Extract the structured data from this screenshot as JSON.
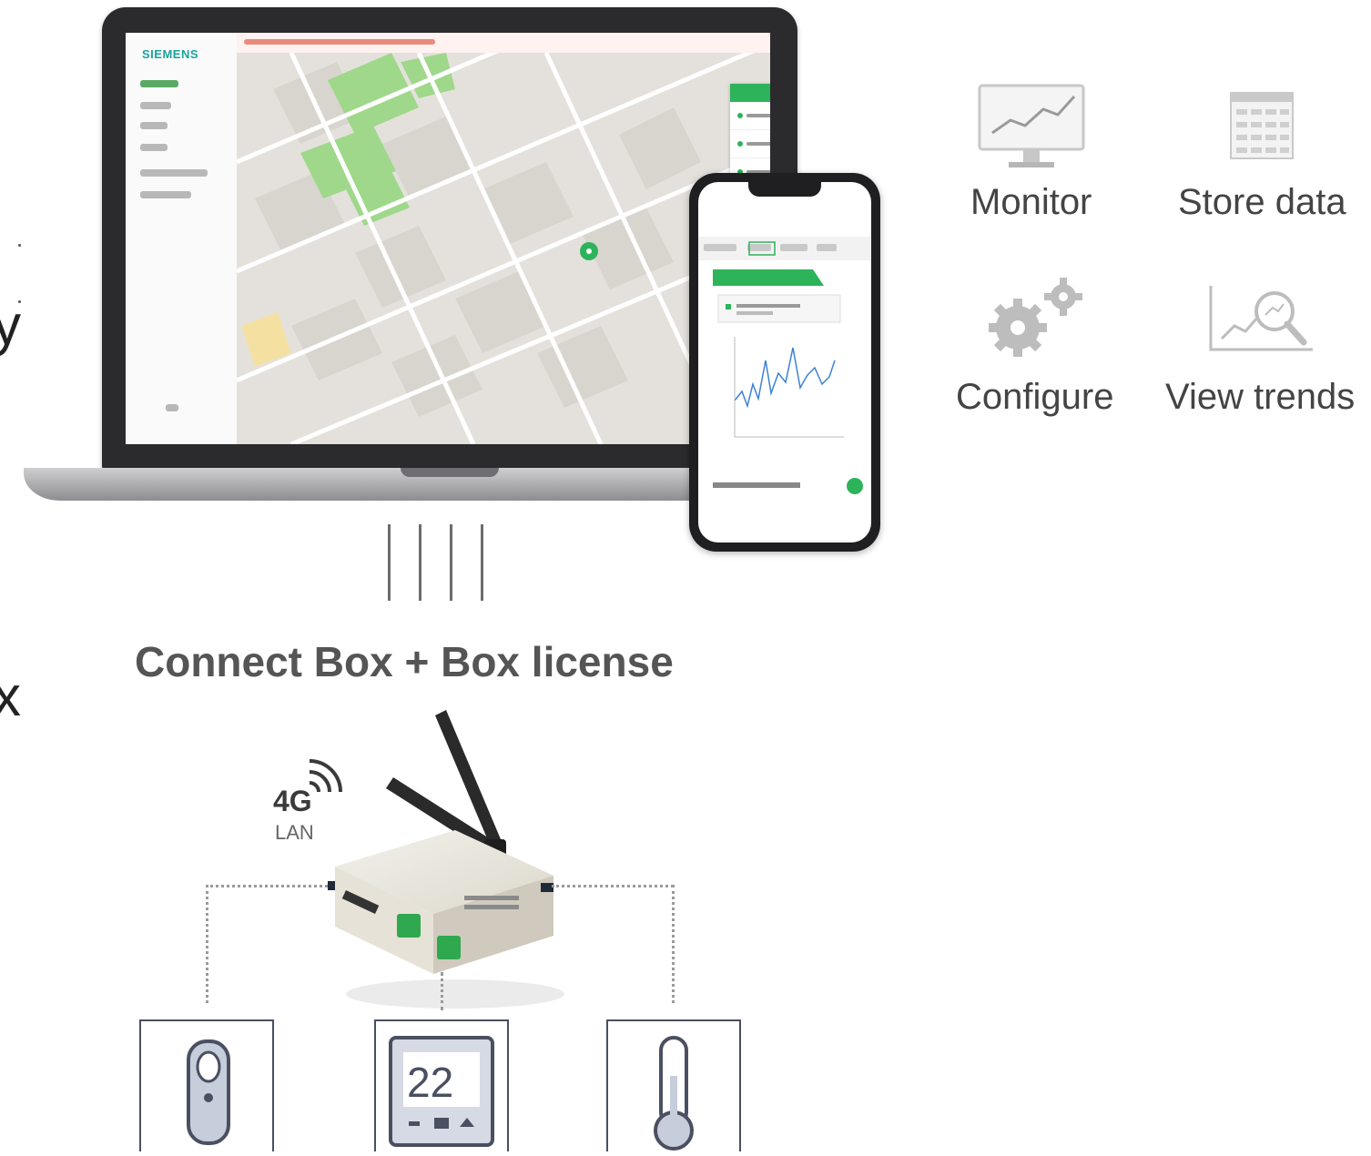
{
  "edge": {
    "letter_top": "y",
    "letter_bottom": "x"
  },
  "laptop": {
    "app_brand": "SIEMENS"
  },
  "connect": {
    "title": "Connect Box + Box license"
  },
  "device": {
    "net_primary": "4G",
    "net_secondary": "LAN"
  },
  "thermostat": {
    "value": "22"
  },
  "features": [
    {
      "label": "Monitor",
      "icon": "monitor-chart-icon"
    },
    {
      "label": "Store data",
      "icon": "data-table-icon"
    },
    {
      "label": "Configure",
      "icon": "gears-icon"
    },
    {
      "label": "View trends",
      "icon": "trend-magnifier-icon"
    }
  ],
  "colors": {
    "accent_green": "#2db35a",
    "box_border": "#4a4f61",
    "headline": "#555555"
  }
}
